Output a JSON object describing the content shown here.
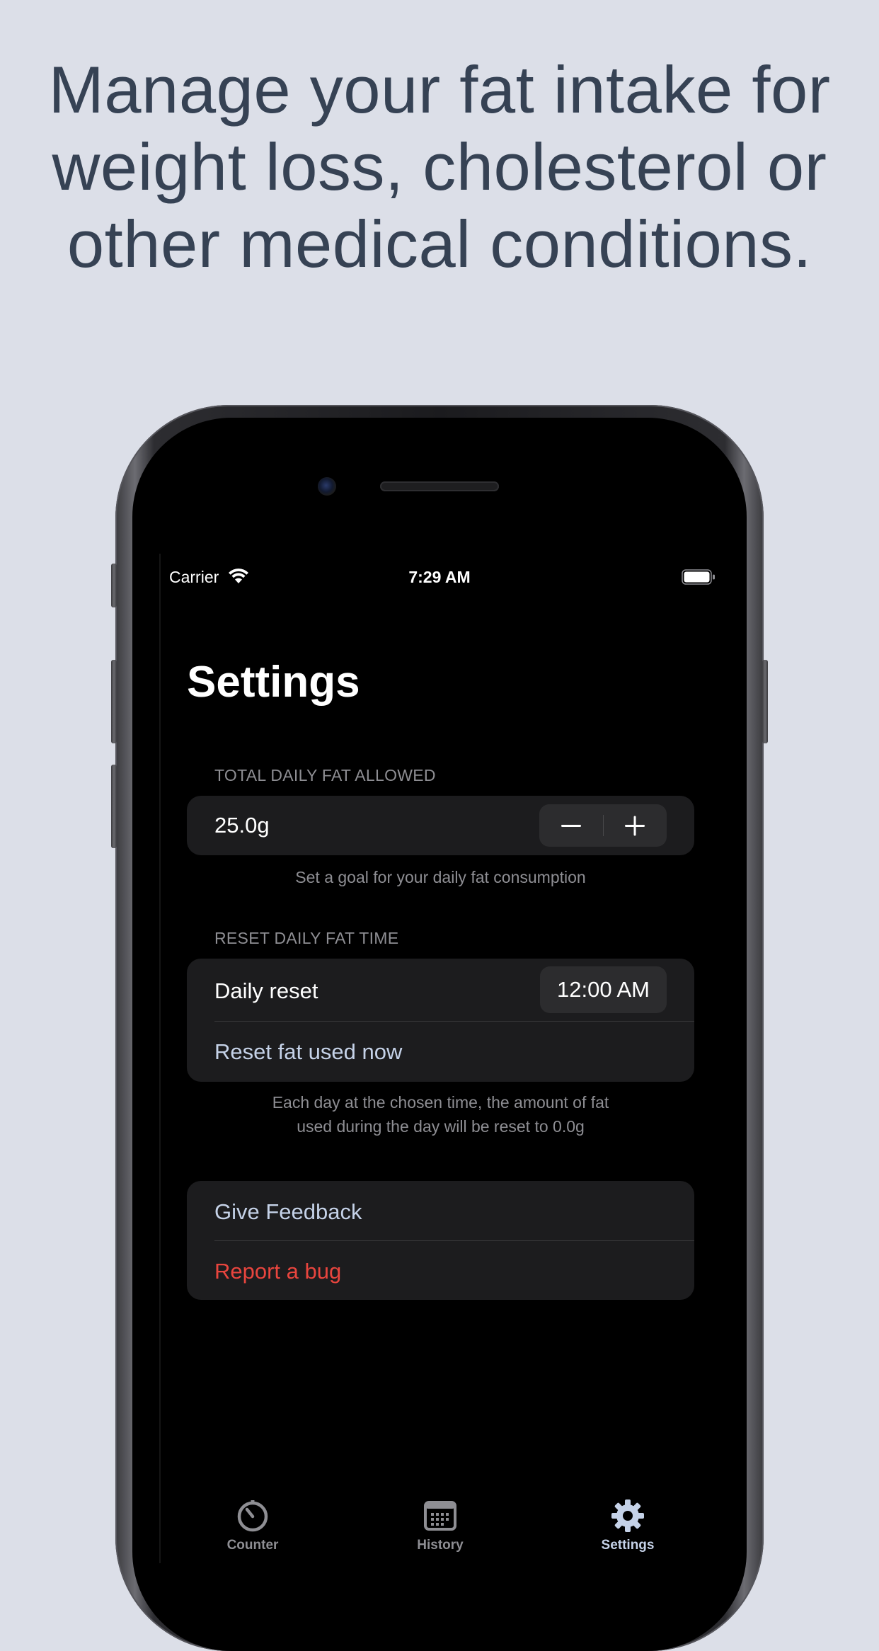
{
  "headline": {
    "line1": "Manage your fat intake for",
    "line2": "weight loss, cholesterol or",
    "line3": "other medical conditions."
  },
  "status_bar": {
    "carrier": "Carrier",
    "time": "7:29 AM"
  },
  "page_title": "Settings",
  "fat_allowed": {
    "header": "TOTAL DAILY FAT ALLOWED",
    "value": "25.0g",
    "footnote": "Set a goal for your daily fat consumption"
  },
  "reset_time": {
    "header": "RESET DAILY FAT TIME",
    "daily_reset_label": "Daily reset",
    "daily_reset_value": "12:00 AM",
    "reset_now_label": "Reset fat used now",
    "footnote_line1": "Each day at the chosen time, the amount of fat",
    "footnote_line2": "used during the day will be reset to 0.0g"
  },
  "support": {
    "feedback_label": "Give Feedback",
    "bug_label": "Report a bug"
  },
  "tabs": [
    {
      "label": "Counter",
      "icon": "stopwatch-icon",
      "active": false
    },
    {
      "label": "History",
      "icon": "calendar-icon",
      "active": false
    },
    {
      "label": "Settings",
      "icon": "gear-icon",
      "active": true
    }
  ],
  "colors": {
    "background": "#dcdfe8",
    "headline": "#364254",
    "accent": "#c5d2e8",
    "danger": "#e8453e"
  }
}
